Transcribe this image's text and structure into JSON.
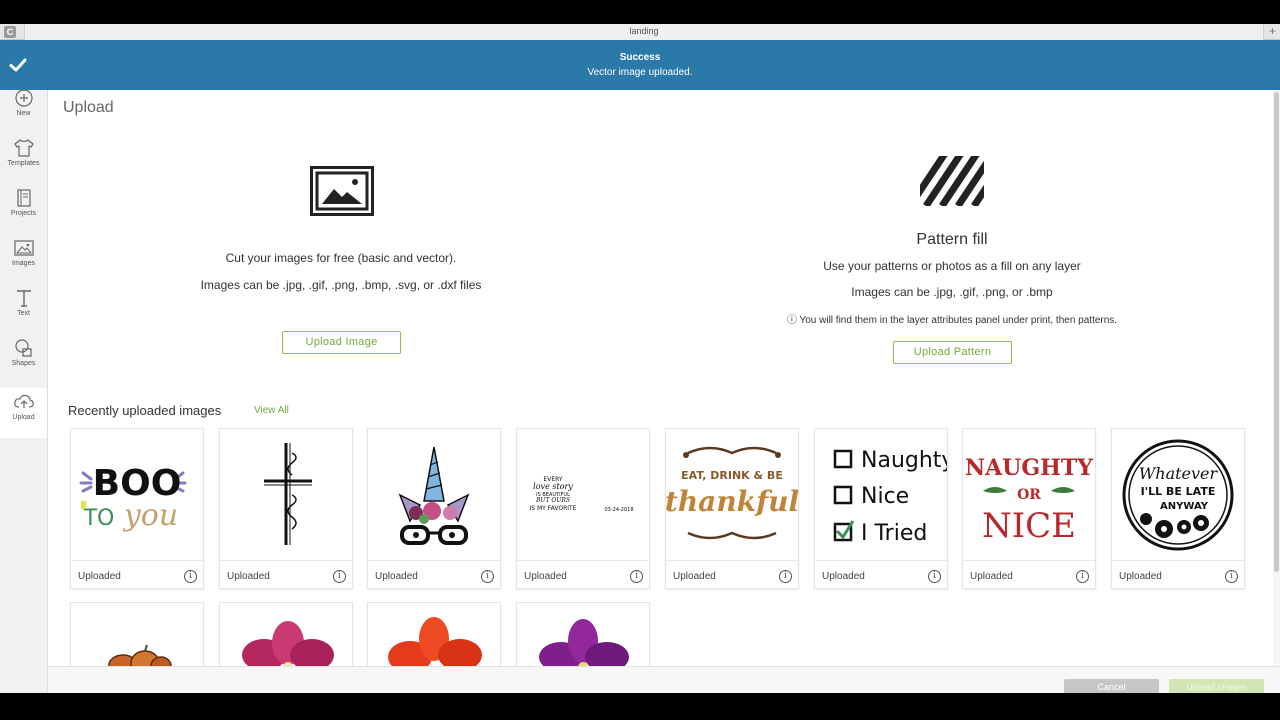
{
  "window": {
    "title": "landing",
    "app_icon": "C",
    "new_tab_glyph": "+"
  },
  "notification": {
    "title": "Success",
    "message": "Vector image uploaded.",
    "color": "#2b79a8"
  },
  "sidebar": {
    "items": [
      {
        "label": "New",
        "icon": "plus-circle-icon"
      },
      {
        "label": "Templates",
        "icon": "tshirt-icon"
      },
      {
        "label": "Projects",
        "icon": "notebook-icon"
      },
      {
        "label": "Images",
        "icon": "image-icon"
      },
      {
        "label": "Text",
        "icon": "text-icon"
      },
      {
        "label": "Shapes",
        "icon": "shapes-icon"
      },
      {
        "label": "Upload",
        "icon": "cloud-upload-icon",
        "active": true
      }
    ]
  },
  "page": {
    "title": "Upload"
  },
  "upload_image": {
    "line1": "Cut your images for free (basic and vector).",
    "line2": "Images can be .jpg, .gif, .png, .bmp, .svg, or .dxf files",
    "button": "Upload Image"
  },
  "upload_pattern": {
    "title": "Pattern fill",
    "line1": "Use your patterns or photos as a fill on any layer",
    "line2": "Images can be .jpg, .gif, .png, or .bmp",
    "note": "ⓘ You will find them in the layer attributes panel under print, then patterns.",
    "button": "Upload Pattern"
  },
  "recent": {
    "title": "Recently uploaded images",
    "view_all": "View All",
    "items": [
      {
        "caption": "Uploaded",
        "name": "boo-to-you",
        "text1": "BOO",
        "text2": "TO",
        "text3": "you"
      },
      {
        "caption": "Uploaded",
        "name": "cross"
      },
      {
        "caption": "Uploaded",
        "name": "unicorn"
      },
      {
        "caption": "Uploaded",
        "name": "love-story",
        "lines": [
          "EVERY",
          "love story",
          "IS BEAUTIFUL",
          "BUT OURS",
          "IS MY FAVORITE"
        ],
        "date": "03-24-2018"
      },
      {
        "caption": "Uploaded",
        "name": "thankful",
        "line1": "EAT, DRINK & BE",
        "line2": "thankful"
      },
      {
        "caption": "Uploaded",
        "name": "naughty-nice-tried",
        "opt1": "Naughty",
        "opt2": "Nice",
        "opt3": "I Tried"
      },
      {
        "caption": "Uploaded",
        "name": "naughty-or-nice",
        "line1": "NAUGHTY",
        "line2": "OR",
        "line3": "NICE"
      },
      {
        "caption": "Uploaded",
        "name": "whatever-late",
        "line1": "Whatever",
        "line2": "I'LL BE LATE",
        "line3": "ANYWAY"
      }
    ],
    "partial_items": [
      {
        "name": "pumpkins"
      },
      {
        "name": "pink-flower"
      },
      {
        "name": "red-flower"
      },
      {
        "name": "purple-flower"
      }
    ],
    "info_glyph": "i"
  },
  "footer": {
    "cancel": "Cancel",
    "upload": "Upload Images"
  }
}
